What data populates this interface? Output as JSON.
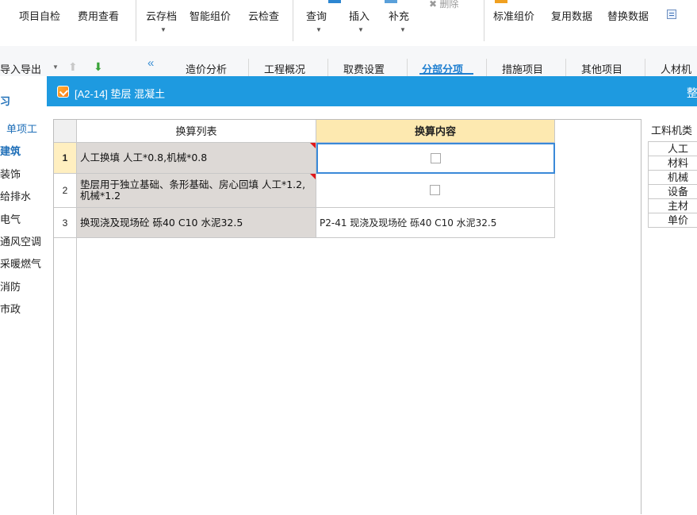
{
  "toolbar": {
    "items": [
      "项目自检",
      "费用查看",
      "云存档",
      "智能组价",
      "云检查",
      "查询",
      "插入",
      "补充",
      "标准组价",
      "复用数据",
      "替换数据"
    ],
    "delete_label": "删除"
  },
  "nav": {
    "import_label": "导入导出",
    "tabs": [
      "造价分析",
      "工程概况",
      "取费设置",
      "分部分项",
      "措施项目",
      "其他项目",
      "人材机"
    ],
    "active_tab": "分部分项"
  },
  "tree": {
    "items": [
      "习",
      "单项工",
      "建筑",
      "装饰",
      "给排水",
      "电气",
      "通风空调",
      "采暖燃气",
      "消防",
      "市政"
    ]
  },
  "dialog": {
    "title": "[A2-14] 垫层 混凝土",
    "title_right": "整",
    "columns": {
      "list": "换算列表",
      "content": "换算内容"
    },
    "rows": [
      {
        "num": "1",
        "list": "人工换填 人工*0.8,机械*0.8",
        "content": ""
      },
      {
        "num": "2",
        "list": "垫层用于独立基础、条形基础、房心回填 人工*1.2,机械*1.2",
        "content": ""
      },
      {
        "num": "3",
        "list": "换现浇及现场砼 砾40 C10 水泥32.5",
        "content": "P2-41  现浇及现场砼 砾40 C10 水泥32.5"
      }
    ]
  },
  "right_panel": {
    "header": "工料机类",
    "items": [
      "人工",
      "材料",
      "机械",
      "设备",
      "主材",
      "单价"
    ]
  }
}
